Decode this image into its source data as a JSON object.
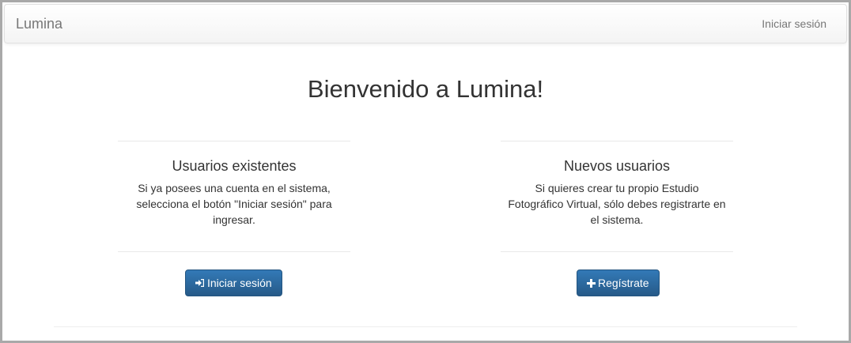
{
  "navbar": {
    "brand": "Lumina",
    "login_link": "Iniciar sesión"
  },
  "hero": {
    "title": "Bienvenido a Lumina!"
  },
  "existing_users": {
    "title": "Usuarios existentes",
    "text": "Si ya posees una cuenta en el sistema, selecciona el botón \"Iniciar sesión\" para ingresar.",
    "button_icon": "sign-in-icon",
    "button_label": "Iniciar sesión"
  },
  "new_users": {
    "title": "Nuevos usuarios",
    "text": "Si quieres crear tu propio Estudio Fotográfico Virtual, sólo debes registrarte en el sistema.",
    "button_icon": "plus-icon",
    "button_label": "Regístrate"
  },
  "colors": {
    "primary_button": "#337ab7",
    "navbar_text": "#777777"
  }
}
